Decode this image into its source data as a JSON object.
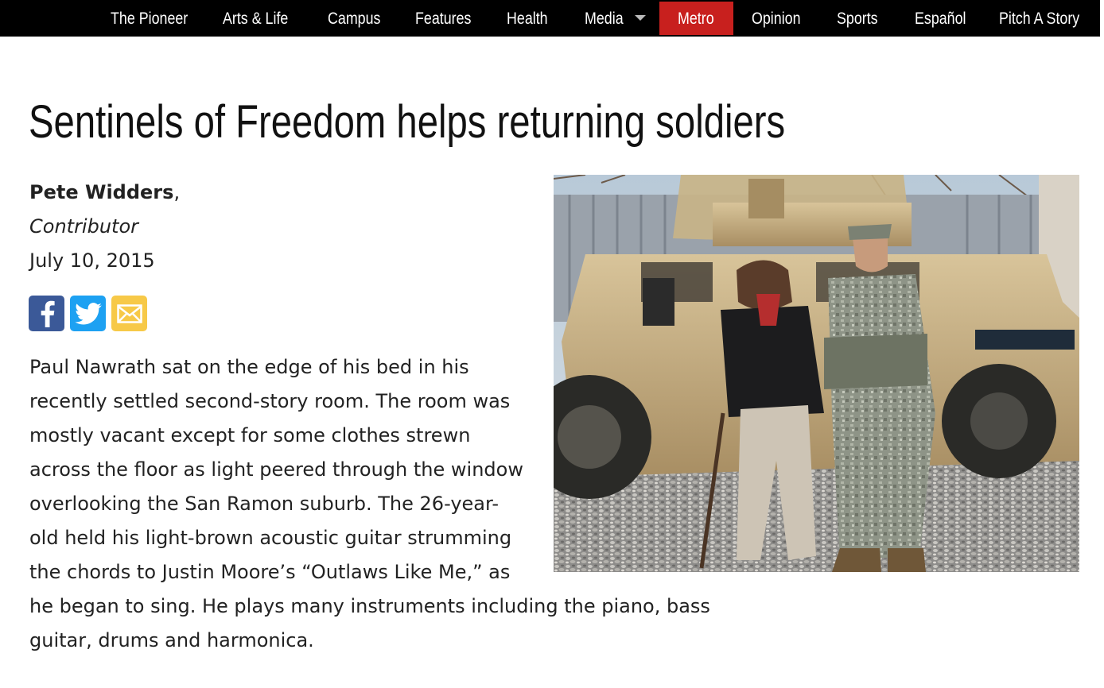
{
  "nav": {
    "items": [
      {
        "label": "The Pioneer"
      },
      {
        "label": "Arts & Life"
      },
      {
        "label": "Campus"
      },
      {
        "label": "Features"
      },
      {
        "label": "Health"
      },
      {
        "label": "Media",
        "has_dropdown": true
      },
      {
        "label": "Metro",
        "active": true
      },
      {
        "label": "Opinion"
      },
      {
        "label": "Sports"
      },
      {
        "label": "Español"
      },
      {
        "label": "Pitch A Story"
      }
    ],
    "active_color": "#c8201e"
  },
  "article": {
    "headline": "Sentinels of Freedom helps returning soldiers",
    "author": "Pete Widders",
    "author_suffix": ",",
    "role": "Contributor",
    "date": "July 10, 2015",
    "share": [
      {
        "icon": "facebook-icon",
        "color": "#3b5998"
      },
      {
        "icon": "twitter-icon",
        "color": "#1da1f2"
      },
      {
        "icon": "email-icon",
        "color": "#f7c948"
      }
    ],
    "paragraph_1": "Paul Nawrath sat on the edge of his bed in his recently settled second-story room. The room was mostly vacant except for some clothes strewn across the floor as light peered through the window overlooking the San Ramon suburb. The 26-year-old held his light-brown acoustic guitar strumming the chords to Justin Moore’s “Outlaws Like Me,” as he began to sing. He plays many instruments including the piano, bass guitar, drums and harmonica."
  }
}
